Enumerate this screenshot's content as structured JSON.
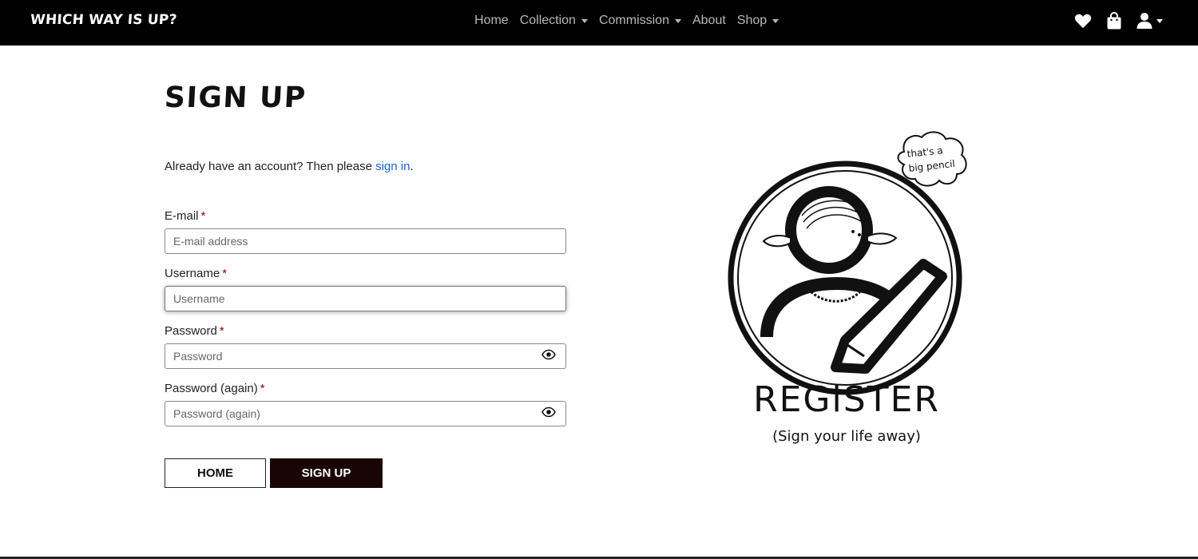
{
  "navbar": {
    "brand": "WHICH WAY IS UP?",
    "links": [
      {
        "label": "Home",
        "dropdown": false
      },
      {
        "label": "Collection",
        "dropdown": true
      },
      {
        "label": "Commission",
        "dropdown": true
      },
      {
        "label": "About",
        "dropdown": false
      },
      {
        "label": "Shop",
        "dropdown": true
      }
    ],
    "icons": [
      "heart-icon",
      "shopping-bag-icon",
      "user-icon"
    ]
  },
  "page": {
    "title": "SIGN UP",
    "intro_prefix": "Already have an account? Then please ",
    "intro_link": "sign in",
    "intro_suffix": "."
  },
  "form": {
    "email": {
      "label": "E-mail",
      "required_mark": "*",
      "placeholder": "E-mail address"
    },
    "username": {
      "label": "Username",
      "required_mark": "*",
      "placeholder": "Username"
    },
    "password": {
      "label": "Password",
      "required_mark": "*",
      "placeholder": "Password"
    },
    "password2": {
      "label": "Password (again)",
      "required_mark": "*",
      "placeholder": "Password (again)"
    }
  },
  "buttons": {
    "home": "HOME",
    "signup": "SIGN UP"
  },
  "illustration": {
    "speech": [
      "that's a",
      "big pencil"
    ],
    "caption": "REGiSTER",
    "subcaption": "(Sign your life away)"
  },
  "colors": {
    "navbar_bg": "#000000",
    "link": "#1a63d6",
    "required": "#8b0000",
    "signup_button": "#1a0505"
  }
}
